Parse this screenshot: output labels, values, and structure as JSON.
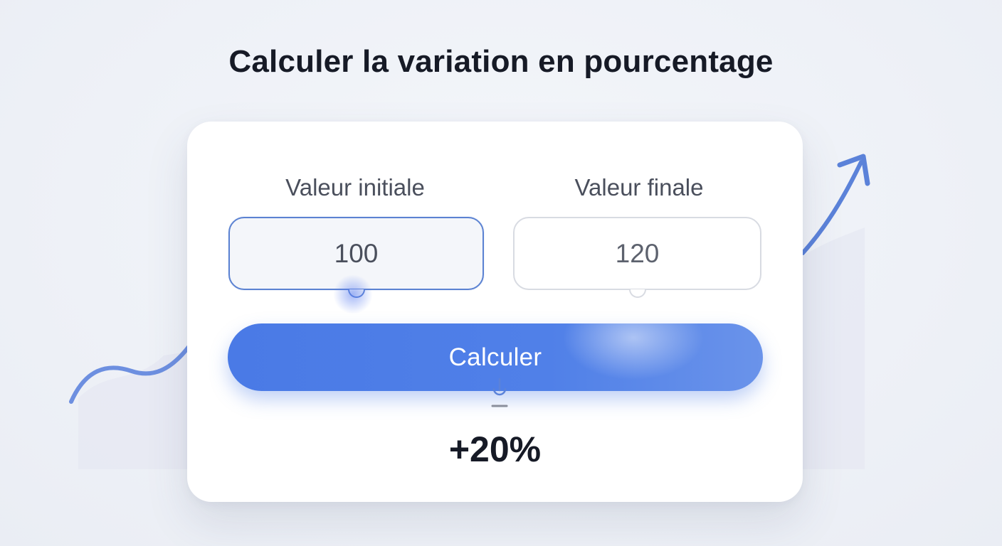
{
  "page": {
    "title": "Calculer la variation en pourcentage"
  },
  "form": {
    "initial_label": "Valeur initiale",
    "initial_value": "100",
    "final_label": "Valeur finale",
    "final_value": "120",
    "button_label": "Calculer",
    "result": "+20%"
  },
  "colors": {
    "accent": "#4a7ae6",
    "title": "#161a26",
    "background": "#eef1f7",
    "card": "#ffffff"
  },
  "icons": {
    "cursor": "pointer-cursor-icon",
    "trend": "trend-arrow-icon"
  }
}
